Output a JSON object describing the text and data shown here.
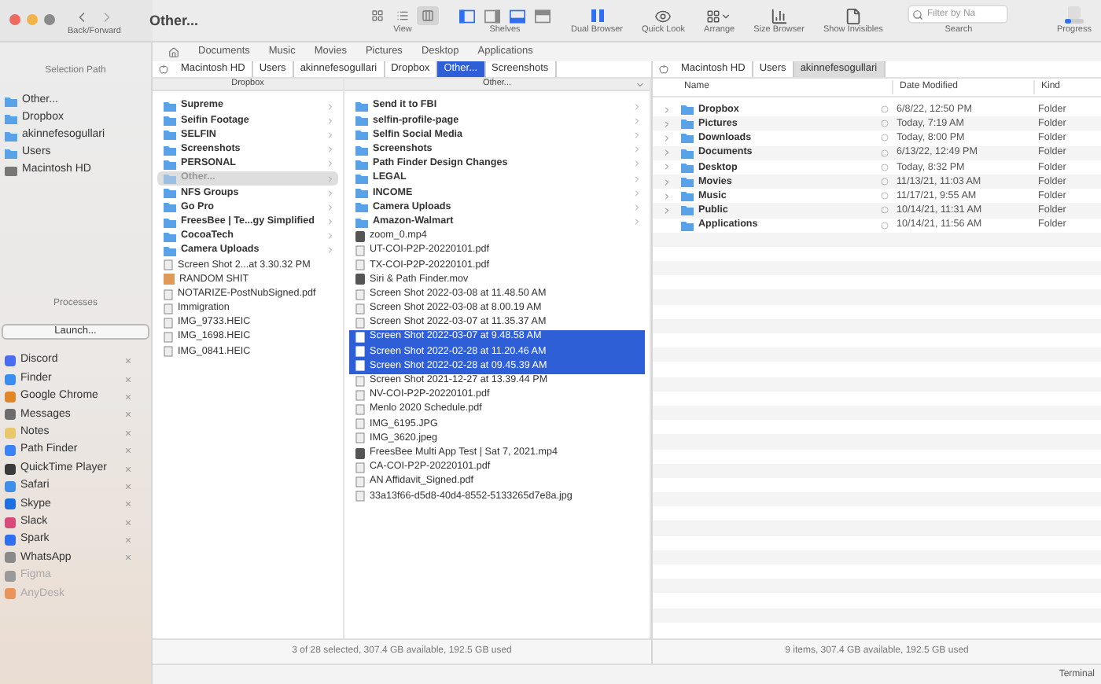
{
  "toolbar": {
    "nav_label": "Back/Forward",
    "title": "Other...",
    "view_modes": [
      {
        "kind": "icons",
        "selected": false
      },
      {
        "kind": "list",
        "selected": false
      },
      {
        "kind": "columns",
        "selected": true
      }
    ],
    "view_label": "View",
    "shelves": [
      {
        "kind": "left",
        "on": true
      },
      {
        "kind": "right",
        "on": false
      },
      {
        "kind": "bottom",
        "on": true
      },
      {
        "kind": "top",
        "on": false
      }
    ],
    "shelves_label": "Shelves",
    "tools": [
      {
        "kind": "dual",
        "label": "Dual Browser"
      },
      {
        "kind": "eye",
        "label": "Quick Look"
      },
      {
        "kind": "arrange",
        "label": "Arrange"
      },
      {
        "kind": "size",
        "label": "Size Browser"
      },
      {
        "kind": "invisibles",
        "label": "Show Invisibles"
      }
    ],
    "search": {
      "placeholder": "Filter by Na",
      "label": "Search"
    },
    "progress_label": "Progress"
  },
  "sidebar": {
    "header": "Selection Path",
    "path": [
      {
        "name": "Other...",
        "kind": "folder"
      },
      {
        "name": "Dropbox",
        "kind": "folder"
      },
      {
        "name": "akinnefesogullari",
        "kind": "folder"
      },
      {
        "name": "Users",
        "kind": "folder"
      },
      {
        "name": "Macintosh HD",
        "kind": "disk"
      }
    ],
    "processes_header": "Processes",
    "launch": "Launch...",
    "apps": [
      {
        "name": "Discord",
        "color": "#4a6cf0",
        "running": true
      },
      {
        "name": "Finder",
        "color": "#3a8ef0",
        "running": true
      },
      {
        "name": "Google Chrome",
        "color": "#e2862a",
        "running": true
      },
      {
        "name": "Messages",
        "color": "#6d6d6d",
        "running": true
      },
      {
        "name": "Notes",
        "color": "#e8c86a",
        "running": true
      },
      {
        "name": "Path Finder",
        "color": "#3b82f6",
        "running": true
      },
      {
        "name": "QuickTime Player",
        "color": "#3a3a3a",
        "running": true
      },
      {
        "name": "Safari",
        "color": "#3f8fe8",
        "running": true
      },
      {
        "name": "Skype",
        "color": "#1e6fe0",
        "running": true
      },
      {
        "name": "Slack",
        "color": "#d84a7a",
        "running": true
      },
      {
        "name": "Spark",
        "color": "#2f6ff0",
        "running": true
      },
      {
        "name": "WhatsApp",
        "color": "#8a8a8a",
        "running": true
      },
      {
        "name": "Figma",
        "color": "#9a9a9a",
        "running": false
      },
      {
        "name": "AnyDesk",
        "color": "#e8945a",
        "running": false
      }
    ]
  },
  "favorites": [
    "Documents",
    "Music",
    "Movies",
    "Pictures",
    "Desktop",
    "Applications"
  ],
  "left_pane": {
    "path": [
      {
        "name": "Macintosh HD",
        "selected": false
      },
      {
        "name": "Users",
        "selected": false
      },
      {
        "name": "akinnefesogullari",
        "selected": false
      },
      {
        "name": "Dropbox",
        "selected": false
      },
      {
        "name": "Other...",
        "selected": true
      },
      {
        "name": "Screenshots",
        "selected": false
      }
    ],
    "columns": [
      {
        "title": "Dropbox",
        "menu": false,
        "active": false,
        "items": [
          {
            "name": "Supreme",
            "kind": "folder",
            "selected": false
          },
          {
            "name": "Seifin Footage",
            "kind": "folder",
            "selected": false
          },
          {
            "name": "SELFIN",
            "kind": "folder",
            "selected": false
          },
          {
            "name": "Screenshots",
            "kind": "folder",
            "selected": false
          },
          {
            "name": "PERSONAL",
            "kind": "folder",
            "selected": false
          },
          {
            "name": "Other...",
            "kind": "folder",
            "selected": true
          },
          {
            "name": "NFS Groups",
            "kind": "folder",
            "selected": false
          },
          {
            "name": "Go Pro",
            "kind": "folder",
            "selected": false
          },
          {
            "name": "FreesBee | Te...gy Simplified",
            "kind": "folder",
            "selected": false
          },
          {
            "name": "CocoaTech",
            "kind": "folder",
            "selected": false
          },
          {
            "name": "Camera Uploads",
            "kind": "folder",
            "selected": false
          },
          {
            "name": "Screen Shot 2...at 3.30.32 PM",
            "kind": "file",
            "selected": false
          },
          {
            "name": "RANDOM SHIT",
            "kind": "thumb",
            "selected": false
          },
          {
            "name": "NOTARIZE-PostNubSigned.pdf",
            "kind": "file",
            "selected": false
          },
          {
            "name": "Immigration",
            "kind": "file",
            "selected": false
          },
          {
            "name": "IMG_9733.HEIC",
            "kind": "file",
            "selected": false
          },
          {
            "name": "IMG_1698.HEIC",
            "kind": "file",
            "selected": false
          },
          {
            "name": "IMG_0841.HEIC",
            "kind": "file",
            "selected": false
          }
        ]
      },
      {
        "title": "Other...",
        "menu": true,
        "active": true,
        "items": [
          {
            "name": "Send it to FBI",
            "kind": "folder",
            "selected": false
          },
          {
            "name": "selfin-profile-page",
            "kind": "folder",
            "selected": false
          },
          {
            "name": "Selfin Social Media",
            "kind": "folder",
            "selected": false
          },
          {
            "name": "Screenshots",
            "kind": "folder",
            "selected": false
          },
          {
            "name": "Path Finder Design Changes",
            "kind": "folder",
            "selected": false
          },
          {
            "name": "LEGAL",
            "kind": "folder",
            "selected": false
          },
          {
            "name": "INCOME",
            "kind": "folder",
            "selected": false
          },
          {
            "name": "Camera Uploads",
            "kind": "folder",
            "selected": false
          },
          {
            "name": "Amazon-Walmart",
            "kind": "folder",
            "selected": false
          },
          {
            "name": "zoom_0.mp4",
            "kind": "video",
            "selected": false
          },
          {
            "name": "UT-COI-P2P-20220101.pdf",
            "kind": "file",
            "selected": false
          },
          {
            "name": "TX-COI-P2P-20220101.pdf",
            "kind": "file",
            "selected": false
          },
          {
            "name": "Siri & Path Finder.mov",
            "kind": "video",
            "selected": false
          },
          {
            "name": "Screen Shot 2022-03-08 at 11.48.50 AM",
            "kind": "file",
            "selected": false
          },
          {
            "name": "Screen Shot 2022-03-08 at 8.00.19 AM",
            "kind": "file",
            "selected": false
          },
          {
            "name": "Screen Shot 2022-03-07 at 11.35.37 AM",
            "kind": "file",
            "selected": false
          },
          {
            "name": "Screen Shot 2022-03-07 at 9.48.58 AM",
            "kind": "file",
            "selected": true
          },
          {
            "name": "Screen Shot 2022-02-28 at 11.20.46 AM",
            "kind": "file",
            "selected": true
          },
          {
            "name": "Screen Shot 2022-02-28 at 09.45.39 AM",
            "kind": "file",
            "selected": true
          },
          {
            "name": "Screen Shot 2021-12-27 at 13.39.44 PM",
            "kind": "file",
            "selected": false
          },
          {
            "name": "NV-COI-P2P-20220101.pdf",
            "kind": "file",
            "selected": false
          },
          {
            "name": "Menlo 2020 Schedule.pdf",
            "kind": "file",
            "selected": false
          },
          {
            "name": "IMG_6195.JPG",
            "kind": "file",
            "selected": false
          },
          {
            "name": "IMG_3620.jpeg",
            "kind": "file",
            "selected": false
          },
          {
            "name": "FreesBee Multi App Test | Sat 7, 2021.mp4",
            "kind": "video",
            "selected": false
          },
          {
            "name": "CA-COI-P2P-20220101.pdf",
            "kind": "file",
            "selected": false
          },
          {
            "name": "AN Affidavit_Signed.pdf",
            "kind": "file",
            "selected": false
          },
          {
            "name": "33a13f66-d5d8-40d4-8552-5133265d7e8a.jpg",
            "kind": "file",
            "selected": false
          }
        ]
      }
    ],
    "status": "3 of 28 selected, 307.4 GB available, 192.5 GB used"
  },
  "right_pane": {
    "path": [
      {
        "name": "Macintosh HD",
        "selected": false
      },
      {
        "name": "Users",
        "selected": false
      },
      {
        "name": "akinnefesogullari",
        "selected": true
      }
    ],
    "columns": [
      "Name",
      "Date Modified",
      "Kind"
    ],
    "rows": [
      {
        "name": "Dropbox",
        "expandable": true,
        "date_modified": "6/8/22, 12:50 PM",
        "kind_label": "Folder"
      },
      {
        "name": "Pictures",
        "expandable": true,
        "date_modified": "Today, 7:19 AM",
        "kind_label": "Folder"
      },
      {
        "name": "Downloads",
        "expandable": true,
        "date_modified": "Today, 8:00 PM",
        "kind_label": "Folder"
      },
      {
        "name": "Documents",
        "expandable": true,
        "date_modified": "6/13/22, 12:49 PM",
        "kind_label": "Folder"
      },
      {
        "name": "Desktop",
        "expandable": true,
        "date_modified": "Today, 8:32 PM",
        "kind_label": "Folder"
      },
      {
        "name": "Movies",
        "expandable": true,
        "date_modified": "11/13/21, 11:03 AM",
        "kind_label": "Folder"
      },
      {
        "name": "Music",
        "expandable": true,
        "date_modified": "11/17/21, 9:55 AM",
        "kind_label": "Folder"
      },
      {
        "name": "Public",
        "expandable": true,
        "date_modified": "10/14/21, 11:31 AM",
        "kind_label": "Folder"
      },
      {
        "name": "Applications",
        "expandable": false,
        "date_modified": "10/14/21, 11:56 AM",
        "kind_label": "Folder"
      }
    ],
    "status": "9 items, 307.4 GB available, 192.5 GB used"
  },
  "bottom_bar": "Terminal"
}
